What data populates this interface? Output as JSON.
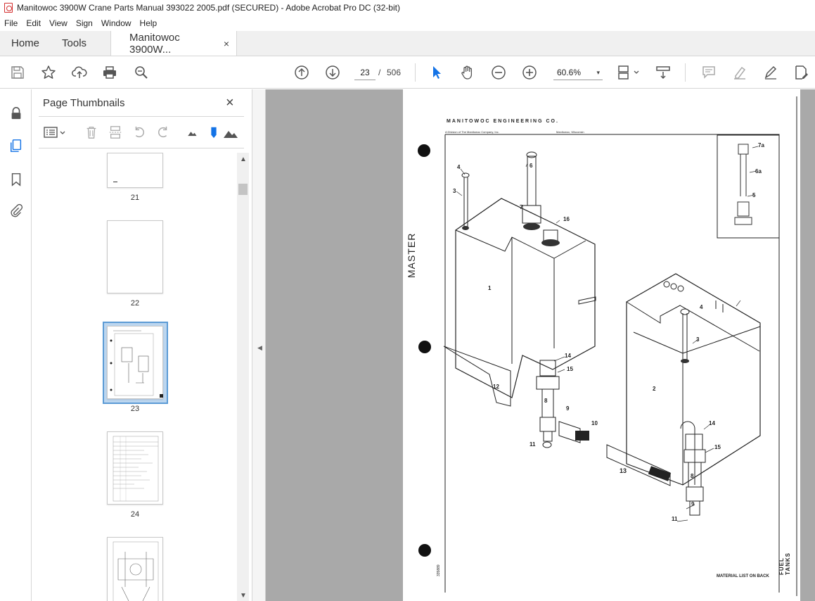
{
  "window": {
    "title": "Manitowoc 3900W Crane Parts Manual 393022 2005.pdf (SECURED) - Adobe Acrobat Pro DC (32-bit)"
  },
  "menu": [
    "File",
    "Edit",
    "View",
    "Sign",
    "Window",
    "Help"
  ],
  "tabs": {
    "home": "Home",
    "tools": "Tools",
    "doc": "Manitowoc 3900W...",
    "doc_close": "×"
  },
  "toolbar": {
    "current_page": "23",
    "separator": "/",
    "total_pages": "506",
    "zoom": "60.6%",
    "zoom_dropdown": "▾",
    "icons": [
      "save-icon",
      "star-icon",
      "upload-icon",
      "print-icon",
      "zoom-search-icon",
      "page-up-icon",
      "page-down-icon",
      "select-cursor-icon",
      "hand-icon",
      "zoom-out-icon",
      "zoom-in-icon",
      "fit-page-icon",
      "scroll-mode-icon",
      "comment-icon",
      "highlight-icon",
      "sign-icon",
      "edit-pdf-icon"
    ]
  },
  "thumbnails": {
    "title": "Page Thumbnails",
    "close": "×",
    "pages": [
      {
        "label": "21"
      },
      {
        "label": "22"
      },
      {
        "label": "23"
      },
      {
        "label": "24"
      },
      {
        "label": ""
      }
    ],
    "selected": "23"
  },
  "document": {
    "company": "MANITOWOC ENGINEERING CO.",
    "subline_left": "A Division of The Manitowoc Company, Inc.",
    "subline_right": "Manitowoc, Wisconsin",
    "master": "MASTER",
    "fuel_tanks": "FUEL TANKS",
    "material_list": "MATERIAL LIST ON BACK",
    "doc_number": "335889",
    "callouts": [
      "7a",
      "6a",
      "5",
      "4",
      "3",
      "6",
      "7",
      "16",
      "1",
      "14",
      "15",
      "12",
      "8",
      "9",
      "10",
      "11",
      "4",
      "3",
      "2",
      "14",
      "15",
      "13",
      "8",
      "9",
      "11"
    ]
  }
}
